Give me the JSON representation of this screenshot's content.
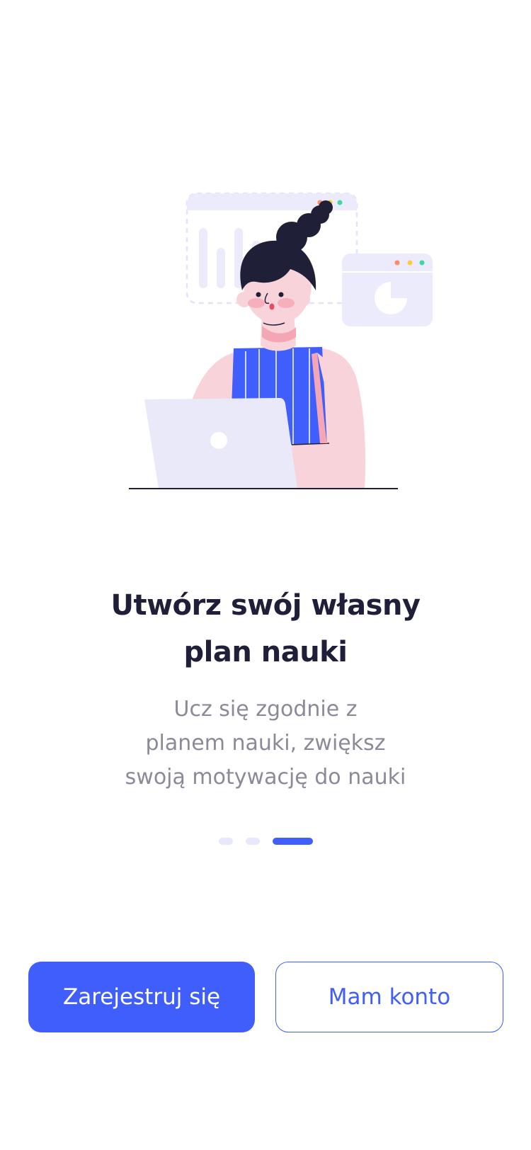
{
  "illustration": {
    "description_icon": "woman-with-laptop-illustration",
    "colors": {
      "panel": "#ebebfb",
      "accent_blue": "#3f5efb",
      "skin": "#f9d3da",
      "hair": "#1f2038",
      "dot_red": "#ff8a65",
      "dot_yellow": "#ffc93d",
      "dot_green": "#42d6a4"
    }
  },
  "onboarding": {
    "title_line1": "Utwórz swój własny",
    "title_line2": "plan nauki",
    "subtitle_line1": "Ucz się zgodnie z",
    "subtitle_line2": "planem nauki, zwiększ",
    "subtitle_line3": "swoją motywację do nauki"
  },
  "pagination": {
    "total": 3,
    "active_index": 3
  },
  "actions": {
    "register_label": "Zarejestruj się",
    "login_label": "Mam konto"
  },
  "colors": {
    "primary": "#3f5efb",
    "title": "#1f1f3a",
    "subtitle": "#8b8a99",
    "inactive_dot": "#e7e8fb"
  }
}
